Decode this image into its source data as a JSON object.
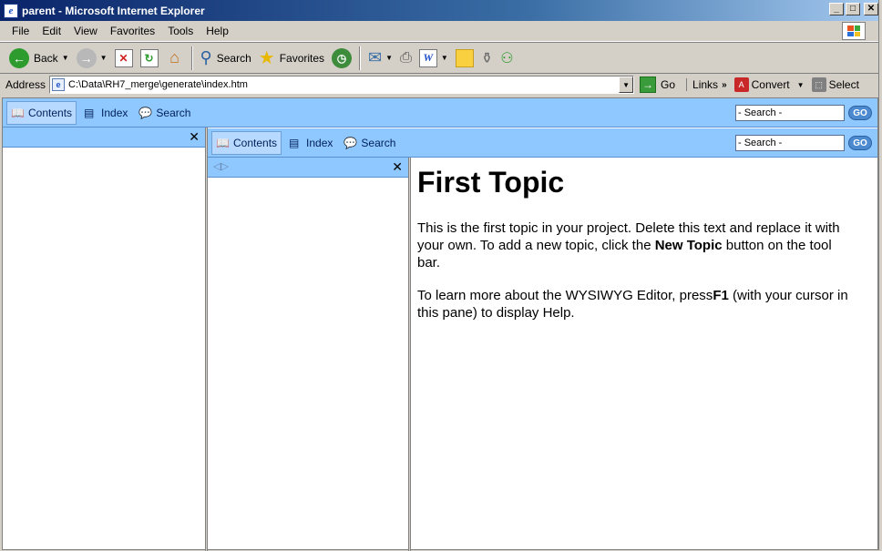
{
  "window": {
    "title": "parent - Microsoft Internet Explorer",
    "minimize": "_",
    "maximize": "□",
    "close": "✕"
  },
  "menu": [
    "File",
    "Edit",
    "View",
    "Favorites",
    "Tools",
    "Help"
  ],
  "toolbar": {
    "back": "Back",
    "search": "Search",
    "favorites": "Favorites"
  },
  "address": {
    "label": "Address",
    "url": "C:\\Data\\RH7_merge\\generate\\index.htm",
    "go": "Go",
    "links": "Links",
    "convert": "Convert",
    "select": "Select"
  },
  "outer_nav": {
    "tabs": [
      "Contents",
      "Index",
      "Search"
    ],
    "search_value": "- Search -",
    "go": "GO"
  },
  "inner_nav": {
    "tabs": [
      "Contents",
      "Index",
      "Search"
    ],
    "search_value": "- Search -",
    "go": "GO"
  },
  "topic": {
    "title": "First Topic",
    "p1_a": "This is the first topic in your project. Delete this text and replace it with your own. To add a new topic, click the ",
    "p1_bold": "New Topic",
    "p1_b": " button on the tool bar.",
    "p2_a": "To learn more about the WYSIWYG Editor, press",
    "p2_bold": "F1",
    "p2_b": " (with your cursor in this pane) to display Help."
  },
  "colors": {
    "nav_blue": "#8fc7ff",
    "title_gradient_start": "#0a246a"
  }
}
